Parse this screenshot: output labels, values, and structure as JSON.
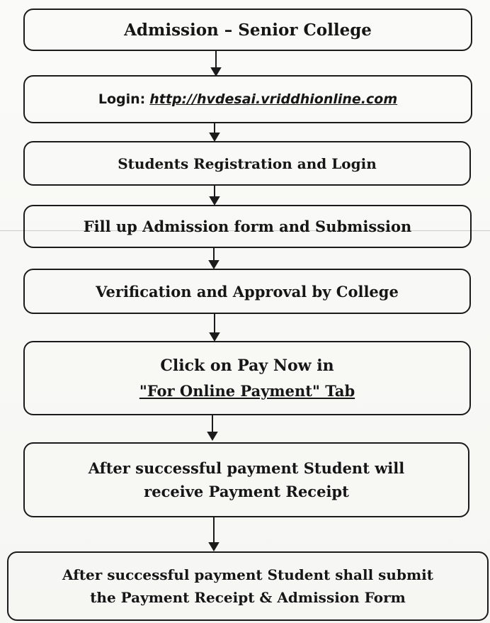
{
  "flowchart": {
    "steps": [
      {
        "text": "Admission – Senior College"
      },
      {
        "label": "Login:",
        "link": "http://hvdesai.vriddhionline.com"
      },
      {
        "text": "Students Registration and Login"
      },
      {
        "text": "Fill up Admission form and Submission"
      },
      {
        "text": "Verification and Approval by College"
      },
      {
        "line1": "Click on Pay Now in",
        "line2": "\"For Online Payment\" Tab"
      },
      {
        "line1": "After successful payment Student will",
        "line2": "receive Payment Receipt"
      },
      {
        "line1": "After successful payment Student shall submit",
        "line2": "the Payment Receipt & Admission Form"
      }
    ]
  }
}
